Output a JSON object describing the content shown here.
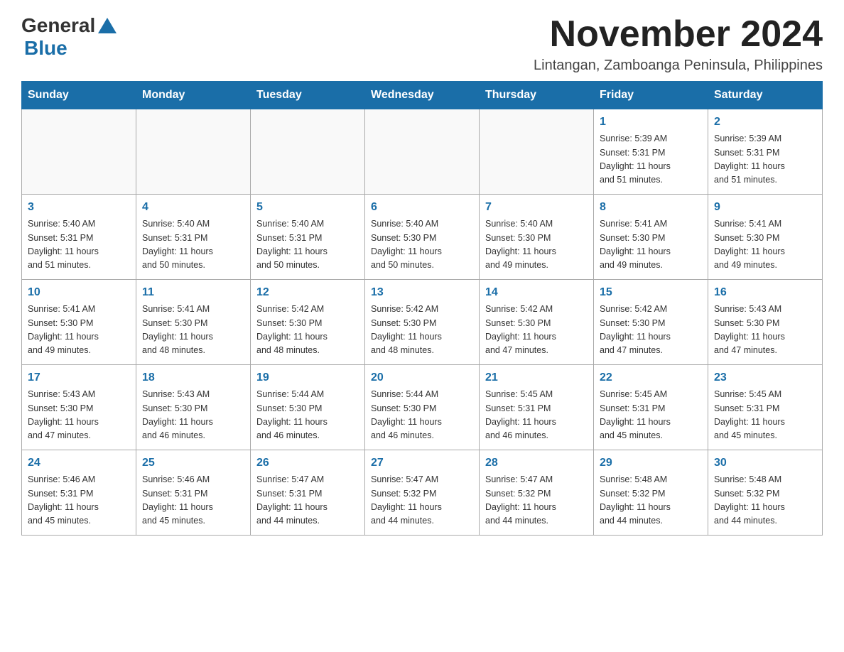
{
  "logo": {
    "text1": "General",
    "text2": "Blue"
  },
  "title": "November 2024",
  "subtitle": "Lintangan, Zamboanga Peninsula, Philippines",
  "days_of_week": [
    "Sunday",
    "Monday",
    "Tuesday",
    "Wednesday",
    "Thursday",
    "Friday",
    "Saturday"
  ],
  "weeks": [
    [
      {
        "day": "",
        "info": ""
      },
      {
        "day": "",
        "info": ""
      },
      {
        "day": "",
        "info": ""
      },
      {
        "day": "",
        "info": ""
      },
      {
        "day": "",
        "info": ""
      },
      {
        "day": "1",
        "info": "Sunrise: 5:39 AM\nSunset: 5:31 PM\nDaylight: 11 hours\nand 51 minutes."
      },
      {
        "day": "2",
        "info": "Sunrise: 5:39 AM\nSunset: 5:31 PM\nDaylight: 11 hours\nand 51 minutes."
      }
    ],
    [
      {
        "day": "3",
        "info": "Sunrise: 5:40 AM\nSunset: 5:31 PM\nDaylight: 11 hours\nand 51 minutes."
      },
      {
        "day": "4",
        "info": "Sunrise: 5:40 AM\nSunset: 5:31 PM\nDaylight: 11 hours\nand 50 minutes."
      },
      {
        "day": "5",
        "info": "Sunrise: 5:40 AM\nSunset: 5:31 PM\nDaylight: 11 hours\nand 50 minutes."
      },
      {
        "day": "6",
        "info": "Sunrise: 5:40 AM\nSunset: 5:30 PM\nDaylight: 11 hours\nand 50 minutes."
      },
      {
        "day": "7",
        "info": "Sunrise: 5:40 AM\nSunset: 5:30 PM\nDaylight: 11 hours\nand 49 minutes."
      },
      {
        "day": "8",
        "info": "Sunrise: 5:41 AM\nSunset: 5:30 PM\nDaylight: 11 hours\nand 49 minutes."
      },
      {
        "day": "9",
        "info": "Sunrise: 5:41 AM\nSunset: 5:30 PM\nDaylight: 11 hours\nand 49 minutes."
      }
    ],
    [
      {
        "day": "10",
        "info": "Sunrise: 5:41 AM\nSunset: 5:30 PM\nDaylight: 11 hours\nand 49 minutes."
      },
      {
        "day": "11",
        "info": "Sunrise: 5:41 AM\nSunset: 5:30 PM\nDaylight: 11 hours\nand 48 minutes."
      },
      {
        "day": "12",
        "info": "Sunrise: 5:42 AM\nSunset: 5:30 PM\nDaylight: 11 hours\nand 48 minutes."
      },
      {
        "day": "13",
        "info": "Sunrise: 5:42 AM\nSunset: 5:30 PM\nDaylight: 11 hours\nand 48 minutes."
      },
      {
        "day": "14",
        "info": "Sunrise: 5:42 AM\nSunset: 5:30 PM\nDaylight: 11 hours\nand 47 minutes."
      },
      {
        "day": "15",
        "info": "Sunrise: 5:42 AM\nSunset: 5:30 PM\nDaylight: 11 hours\nand 47 minutes."
      },
      {
        "day": "16",
        "info": "Sunrise: 5:43 AM\nSunset: 5:30 PM\nDaylight: 11 hours\nand 47 minutes."
      }
    ],
    [
      {
        "day": "17",
        "info": "Sunrise: 5:43 AM\nSunset: 5:30 PM\nDaylight: 11 hours\nand 47 minutes."
      },
      {
        "day": "18",
        "info": "Sunrise: 5:43 AM\nSunset: 5:30 PM\nDaylight: 11 hours\nand 46 minutes."
      },
      {
        "day": "19",
        "info": "Sunrise: 5:44 AM\nSunset: 5:30 PM\nDaylight: 11 hours\nand 46 minutes."
      },
      {
        "day": "20",
        "info": "Sunrise: 5:44 AM\nSunset: 5:30 PM\nDaylight: 11 hours\nand 46 minutes."
      },
      {
        "day": "21",
        "info": "Sunrise: 5:45 AM\nSunset: 5:31 PM\nDaylight: 11 hours\nand 46 minutes."
      },
      {
        "day": "22",
        "info": "Sunrise: 5:45 AM\nSunset: 5:31 PM\nDaylight: 11 hours\nand 45 minutes."
      },
      {
        "day": "23",
        "info": "Sunrise: 5:45 AM\nSunset: 5:31 PM\nDaylight: 11 hours\nand 45 minutes."
      }
    ],
    [
      {
        "day": "24",
        "info": "Sunrise: 5:46 AM\nSunset: 5:31 PM\nDaylight: 11 hours\nand 45 minutes."
      },
      {
        "day": "25",
        "info": "Sunrise: 5:46 AM\nSunset: 5:31 PM\nDaylight: 11 hours\nand 45 minutes."
      },
      {
        "day": "26",
        "info": "Sunrise: 5:47 AM\nSunset: 5:31 PM\nDaylight: 11 hours\nand 44 minutes."
      },
      {
        "day": "27",
        "info": "Sunrise: 5:47 AM\nSunset: 5:32 PM\nDaylight: 11 hours\nand 44 minutes."
      },
      {
        "day": "28",
        "info": "Sunrise: 5:47 AM\nSunset: 5:32 PM\nDaylight: 11 hours\nand 44 minutes."
      },
      {
        "day": "29",
        "info": "Sunrise: 5:48 AM\nSunset: 5:32 PM\nDaylight: 11 hours\nand 44 minutes."
      },
      {
        "day": "30",
        "info": "Sunrise: 5:48 AM\nSunset: 5:32 PM\nDaylight: 11 hours\nand 44 minutes."
      }
    ]
  ]
}
